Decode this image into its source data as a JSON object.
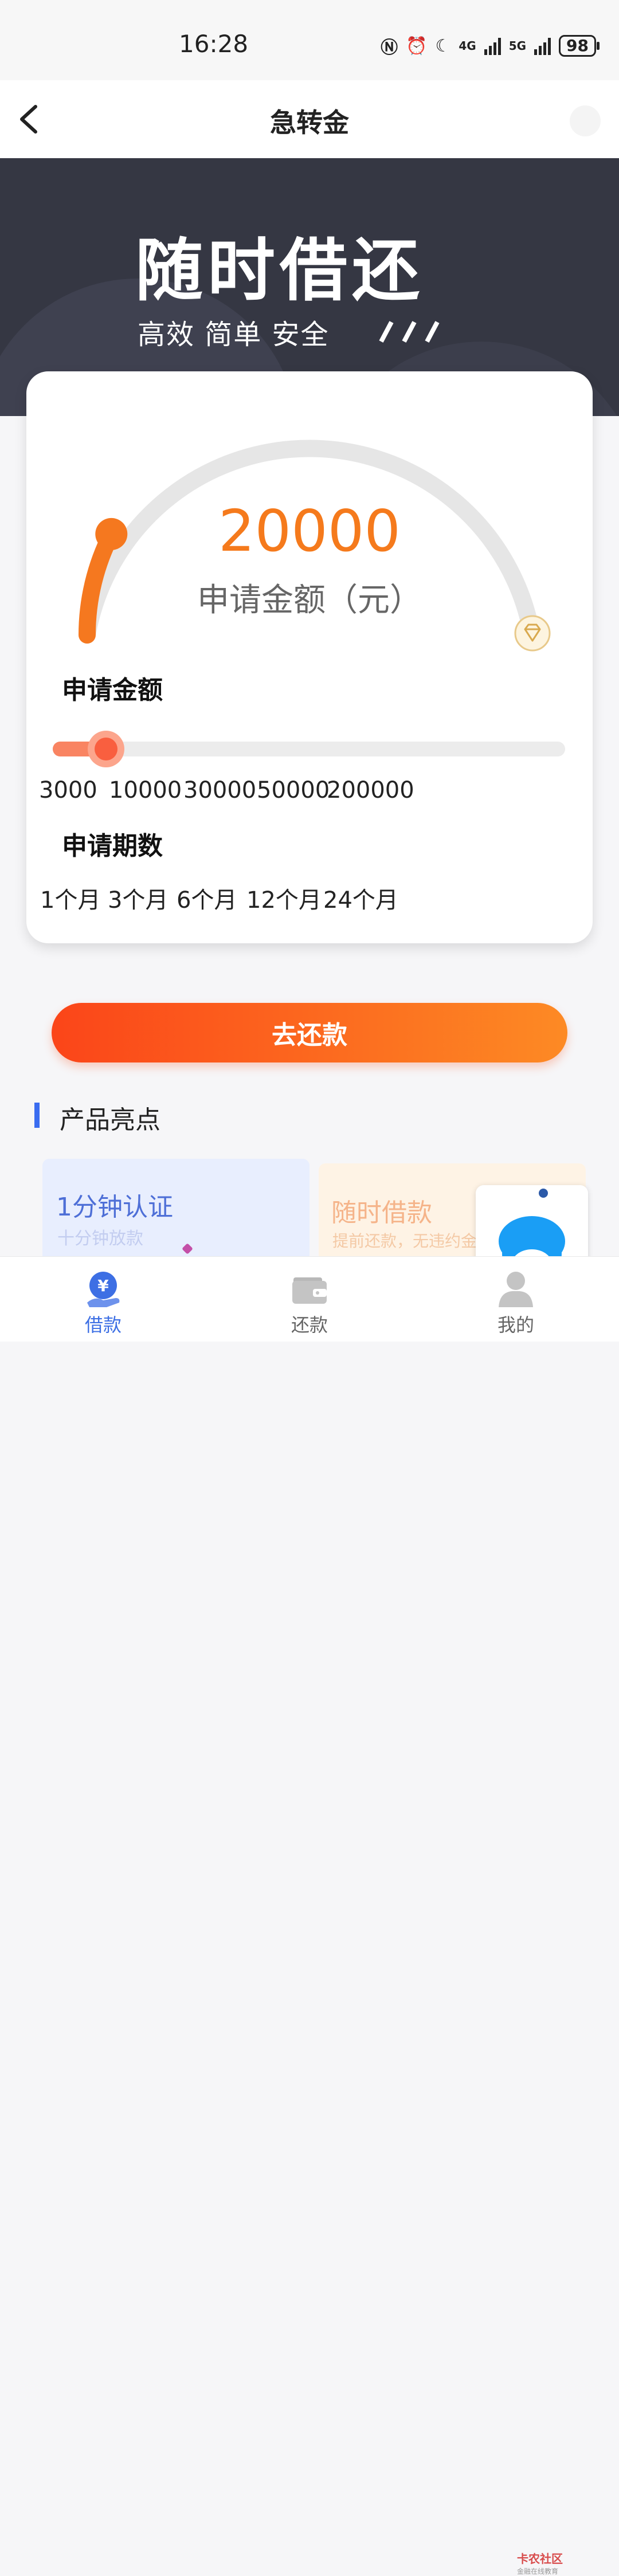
{
  "status_bar": {
    "time": "16:28",
    "network1": "4G",
    "network2": "5G",
    "battery": "98"
  },
  "nav": {
    "title": "急转金"
  },
  "banner": {
    "title": "随时借还",
    "subtitle": "高效 简单 安全"
  },
  "gauge": {
    "amount": "20000",
    "label": "申请金额（元）",
    "fill_fraction": 0.15
  },
  "amount_section": {
    "title": "申请金额",
    "slider_fraction": 0.1,
    "ticks": [
      "3000",
      "10000",
      "30000",
      "50000",
      "200000"
    ]
  },
  "period_section": {
    "title": "申请期数",
    "options": [
      "1个月",
      "3个月",
      "6个月",
      "12个月",
      "24个月"
    ]
  },
  "repay_button": {
    "label": "去还款"
  },
  "highlights": {
    "title": "产品亮点",
    "items": [
      {
        "title": "1分钟认证",
        "subtitle": "十分钟放款"
      },
      {
        "title": "随时借款",
        "subtitle": "提前还款，无违约金"
      }
    ]
  },
  "tabbar": {
    "items": [
      {
        "label": "借款",
        "icon": "yen-hand-icon",
        "active": true
      },
      {
        "label": "还款",
        "icon": "wallet-icon",
        "active": false
      },
      {
        "label": "我的",
        "icon": "user-icon",
        "active": false
      }
    ]
  },
  "watermark": {
    "text": "卡农社区",
    "sub": "金融在线教育"
  },
  "colors": {
    "accent_orange": "#f57a1c",
    "brand_blue": "#3d6fe4",
    "banner_bg": "#353743"
  }
}
